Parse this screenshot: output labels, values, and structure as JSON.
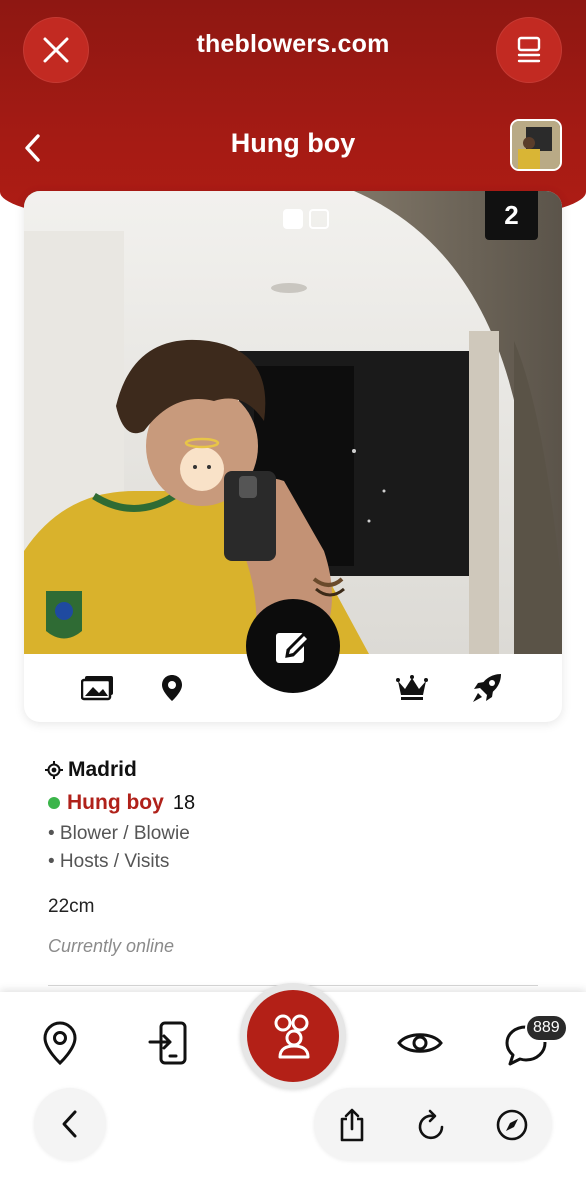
{
  "browser": {
    "url": "theblowers.com",
    "close_icon": "close-icon",
    "menu_icon": "tabs-menu-icon"
  },
  "header": {
    "title": "Hung boy",
    "back_icon": "chevron-left-icon",
    "avatar": "profile-thumbnail"
  },
  "profile_card": {
    "photo_count": "2",
    "pager": {
      "total": 2,
      "current": 1
    },
    "icons": [
      "photos-icon",
      "location-pin-icon",
      "edit-icon",
      "crown-icon",
      "rocket-icon"
    ]
  },
  "profile": {
    "city": "Madrid",
    "name": "Hung boy",
    "age": "18",
    "tags": [
      "• Blower / Blowie",
      "• Hosts / Visits"
    ],
    "size": "22cm",
    "status": "Currently online",
    "colors": {
      "name": "#b0211a",
      "online": "#3bb54a"
    }
  },
  "bottom_nav": {
    "items": [
      "map-pin-icon",
      "login-device-icon",
      "people-icon",
      "eye-icon",
      "chat-icon"
    ],
    "messages_badge": "889"
  },
  "browser_toolbar": {
    "items": [
      "back-icon",
      "share-icon",
      "reload-icon",
      "compass-icon"
    ]
  },
  "theme": {
    "header_red": "#a51b14",
    "accent_red": "#b32017"
  }
}
